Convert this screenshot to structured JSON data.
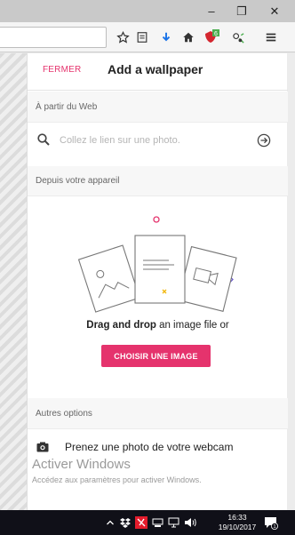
{
  "browser": {
    "window_controls": {
      "minimize": "–",
      "maximize": "❐",
      "close": "✕"
    },
    "toolbar_icons": [
      "star-icon",
      "reading-list-icon",
      "download-icon",
      "home-icon",
      "shield-extension-icon",
      "extension-icon",
      "menu-icon"
    ],
    "extension_badge": "6"
  },
  "panel": {
    "close_label": "FERMER",
    "title": "Add a wallpaper",
    "web_section": {
      "label": "À partir du Web",
      "search_placeholder": "Collez le lien sur une photo."
    },
    "device_section": {
      "label": "Depuis votre appareil",
      "drag_bold": "Drag and drop",
      "drag_rest": " an image file or",
      "choose_button": "CHOISIR UNE IMAGE"
    },
    "other_section": {
      "label": "Autres options",
      "webcam_label": "Prenez une photo de votre webcam"
    },
    "accent_color": "#e5336d"
  },
  "watermark": {
    "title": "Activer Windows",
    "subtitle": "Accédez aux paramètres pour activer Windows."
  },
  "taskbar": {
    "time": "16:33",
    "date": "19/10/2017",
    "notification_count": "1",
    "tray_icons": [
      "chevron-up-icon",
      "dropbox-icon",
      "antivirus-icon",
      "network-icon",
      "display-icon",
      "volume-icon",
      "notification-icon"
    ]
  }
}
